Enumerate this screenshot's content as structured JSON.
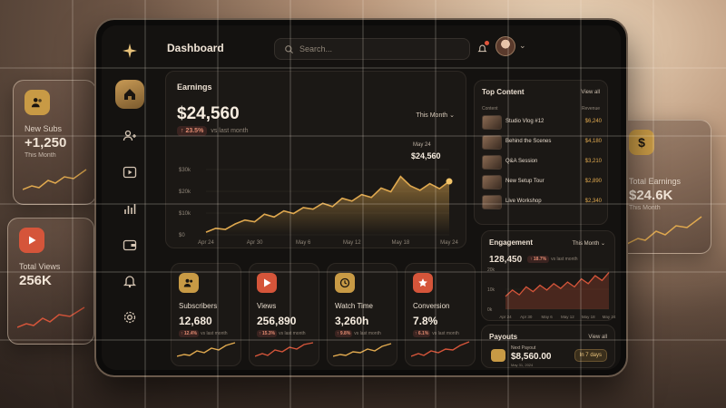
{
  "sidebar": {
    "logo_icon": "sparkle-icon",
    "items": [
      {
        "icon": "home-icon",
        "active": true
      },
      {
        "icon": "users-icon"
      },
      {
        "icon": "play-icon"
      },
      {
        "icon": "bar-chart-icon"
      },
      {
        "icon": "wallet-icon"
      },
      {
        "icon": "bell-icon"
      },
      {
        "icon": "gear-icon"
      }
    ]
  },
  "header": {
    "title": "Dashboard",
    "search_placeholder": "Search..."
  },
  "earnings": {
    "title": "Earnings",
    "total": "$24,560",
    "change": "23.5%",
    "change_suffix": "vs last month",
    "range": "This Month",
    "tooltip_date": "May 24",
    "tooltip_value": "$24,560"
  },
  "chart_data": {
    "type": "area",
    "x": [
      "Apr 24",
      "Apr 30",
      "May 6",
      "May 12",
      "May 18",
      "May 24"
    ],
    "y_ticks": [
      "$30k",
      "$20k",
      "$10k",
      "$0"
    ],
    "ylim": [
      0,
      30000
    ],
    "values": [
      1200,
      3000,
      2500,
      5000,
      6800,
      6000,
      9500,
      8200,
      11000,
      9800,
      12500,
      11800,
      14500,
      13000,
      16800,
      15500,
      18500,
      17200,
      21500,
      19800,
      26800,
      22500,
      20500,
      23500,
      21200,
      24560
    ],
    "accent": "#e0a94f"
  },
  "top_content": {
    "title": "Top Content",
    "view_all": "View all",
    "col_content": "Content",
    "col_revenue": "Revenue",
    "rows": [
      {
        "name": "Studio Vlog #12",
        "revenue": "$6,240"
      },
      {
        "name": "Behind the Scenes",
        "revenue": "$4,180"
      },
      {
        "name": "Q&A Session",
        "revenue": "$3,210"
      },
      {
        "name": "New Setup Tour",
        "revenue": "$2,890"
      },
      {
        "name": "Live Workshop",
        "revenue": "$2,340"
      }
    ]
  },
  "engagement": {
    "title": "Engagement",
    "range": "This Month",
    "value": "128,450",
    "change": "18.7%",
    "change_suffix": "vs last month",
    "y_ticks": [
      "20k",
      "10k",
      "0k"
    ],
    "x_ticks": [
      "Apr 24",
      "Apr 30",
      "May 6",
      "May 12",
      "May 18",
      "May 24"
    ],
    "values": [
      8,
      12,
      9,
      14,
      11,
      15,
      12,
      16,
      13,
      17,
      14,
      19,
      16,
      21,
      18,
      23
    ]
  },
  "stats": [
    {
      "label": "Subscribers",
      "value": "12,680",
      "change": "12.4%",
      "suffix": "vs last month",
      "icon": "users-icon",
      "color": "#c89a45"
    },
    {
      "label": "Views",
      "value": "256,890",
      "change": "15.3%",
      "suffix": "vs last month",
      "icon": "play-icon",
      "color": "#d5553a"
    },
    {
      "label": "Watch Time",
      "value": "3,260h",
      "change": "9.8%",
      "suffix": "vs last month",
      "icon": "clock-icon",
      "color": "#c89a45"
    },
    {
      "label": "Conversion",
      "value": "7.8%",
      "change": "6.1%",
      "suffix": "vs last month",
      "icon": "star-icon",
      "color": "#d5553a"
    }
  ],
  "payouts": {
    "title": "Payouts",
    "view_all": "View all",
    "next_label": "Next Payout",
    "amount": "$8,560.00",
    "date": "May 31, 2024",
    "badge": "In 7 days"
  },
  "glass_cards": [
    {
      "label": "New Subs",
      "value": "+1,250",
      "sub": "This Month",
      "icon": "users-icon",
      "color": "#c89a45"
    },
    {
      "label": "Total Views",
      "value": "256K",
      "sub": "This Month",
      "icon": "play-icon",
      "color": "#d5553a"
    },
    {
      "label": "Total Earnings",
      "value": "$24.6K",
      "sub": "This Month",
      "icon": "dollar-icon",
      "color": "#c89a45"
    }
  ]
}
